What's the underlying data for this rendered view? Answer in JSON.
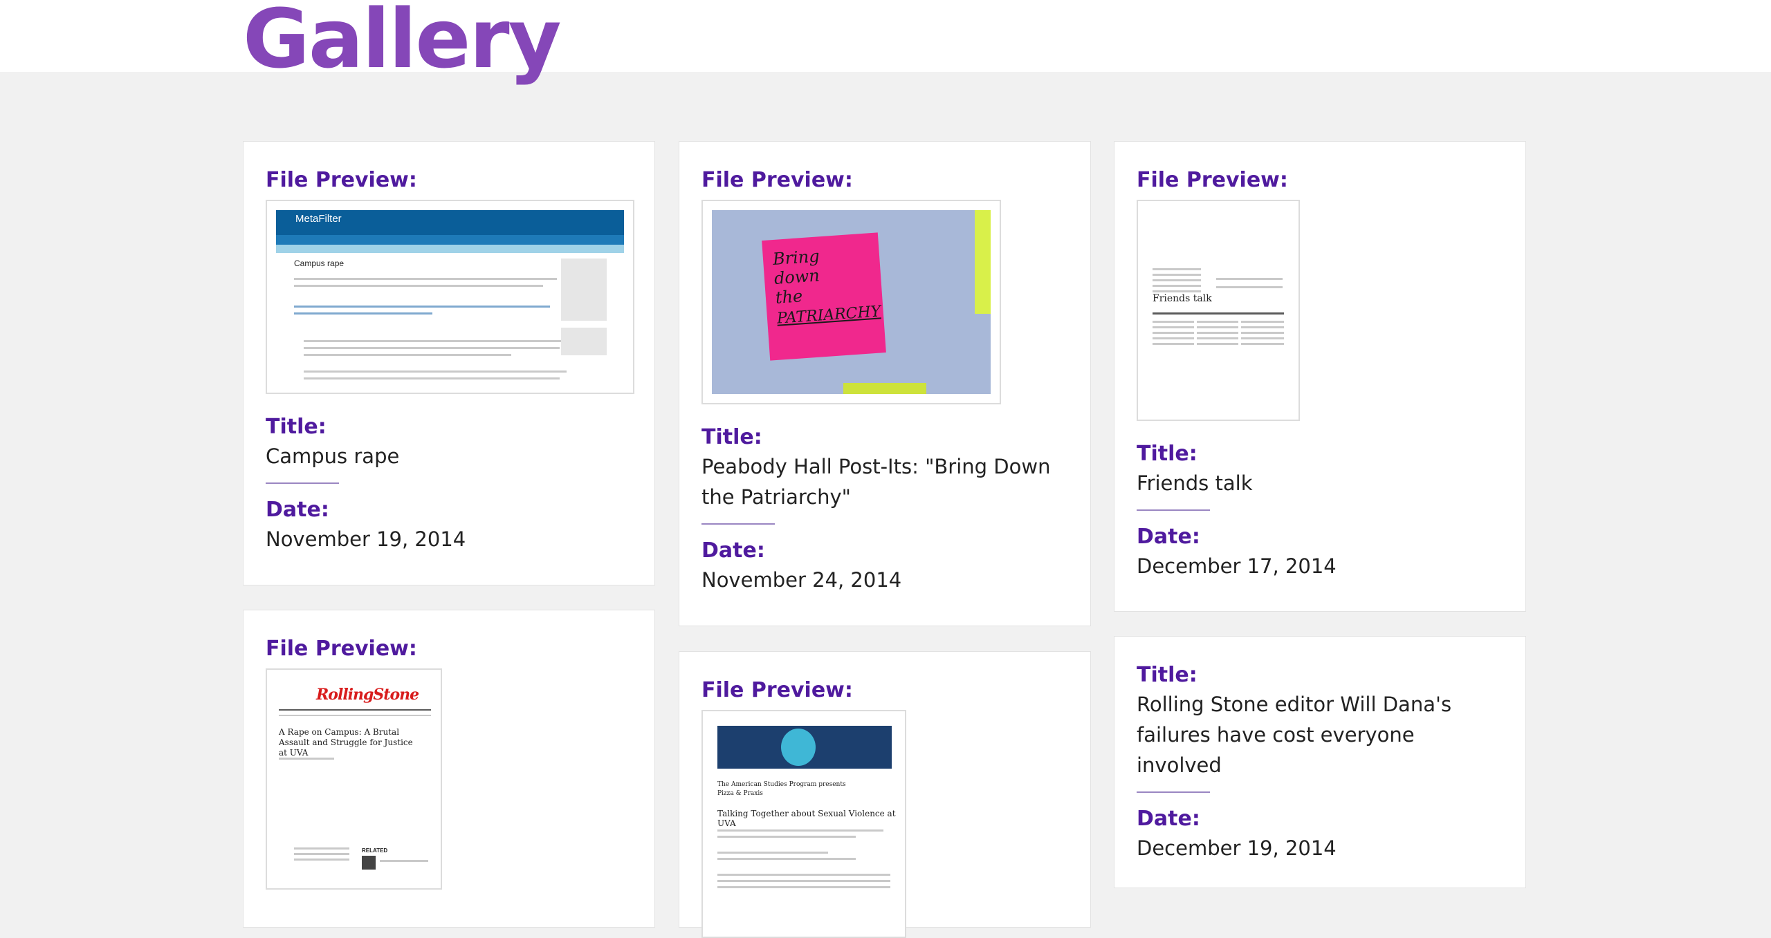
{
  "header": {
    "title": "Gallery"
  },
  "labels": {
    "file_preview": "File Preview:",
    "title": "Title:",
    "date": "Date:"
  },
  "items": [
    {
      "title": "Campus rape",
      "date": "November 19, 2014",
      "preview": {
        "site": "MetaFilter",
        "heading": "Campus rape"
      }
    },
    {
      "title": "Peabody Hall Post-Its: \"Bring Down the Patriarchy\"",
      "date": "November 24, 2014",
      "preview": {
        "note_line1": "Bring down",
        "note_line2": "the",
        "note_line3": "PATRIARCHY"
      }
    },
    {
      "title": "Friends talk",
      "date": "December 17, 2014",
      "preview": {
        "heading": "Friends talk"
      }
    },
    {
      "preview": {
        "masthead": "RollingStone",
        "headline": "A Rape on Campus: A Brutal Assault and Struggle for Justice at UVA",
        "related": "RELATED"
      }
    },
    {
      "preview": {
        "line1": "The American Studies Program presents",
        "line2": "Pizza & Praxis",
        "heading": "Talking Together about Sexual Violence at UVA"
      }
    },
    {
      "title": "Rolling Stone editor Will Dana's failures have cost everyone involved",
      "date": "December 19, 2014"
    }
  ]
}
